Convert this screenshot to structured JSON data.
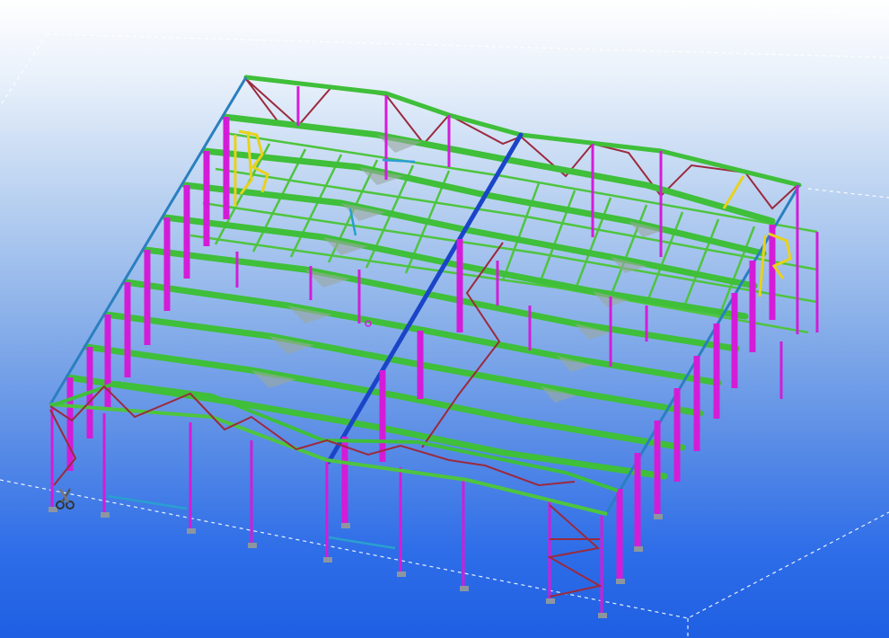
{
  "app": {
    "view": "3D model view"
  },
  "colors": {
    "background_top": "#ffffff",
    "background_bottom": "#1e5fe3",
    "column": "#d41cd8",
    "rafter": "#3fbf3a",
    "purlin": "#4ec53e",
    "bracing": "#9b2a3e",
    "edge_member": "#2a7fc0",
    "ridge": "#1a45c8",
    "gridline": "#ffffff",
    "stair": "#e8d21a"
  },
  "icons": {
    "cut_tool": "scissors-icon"
  }
}
